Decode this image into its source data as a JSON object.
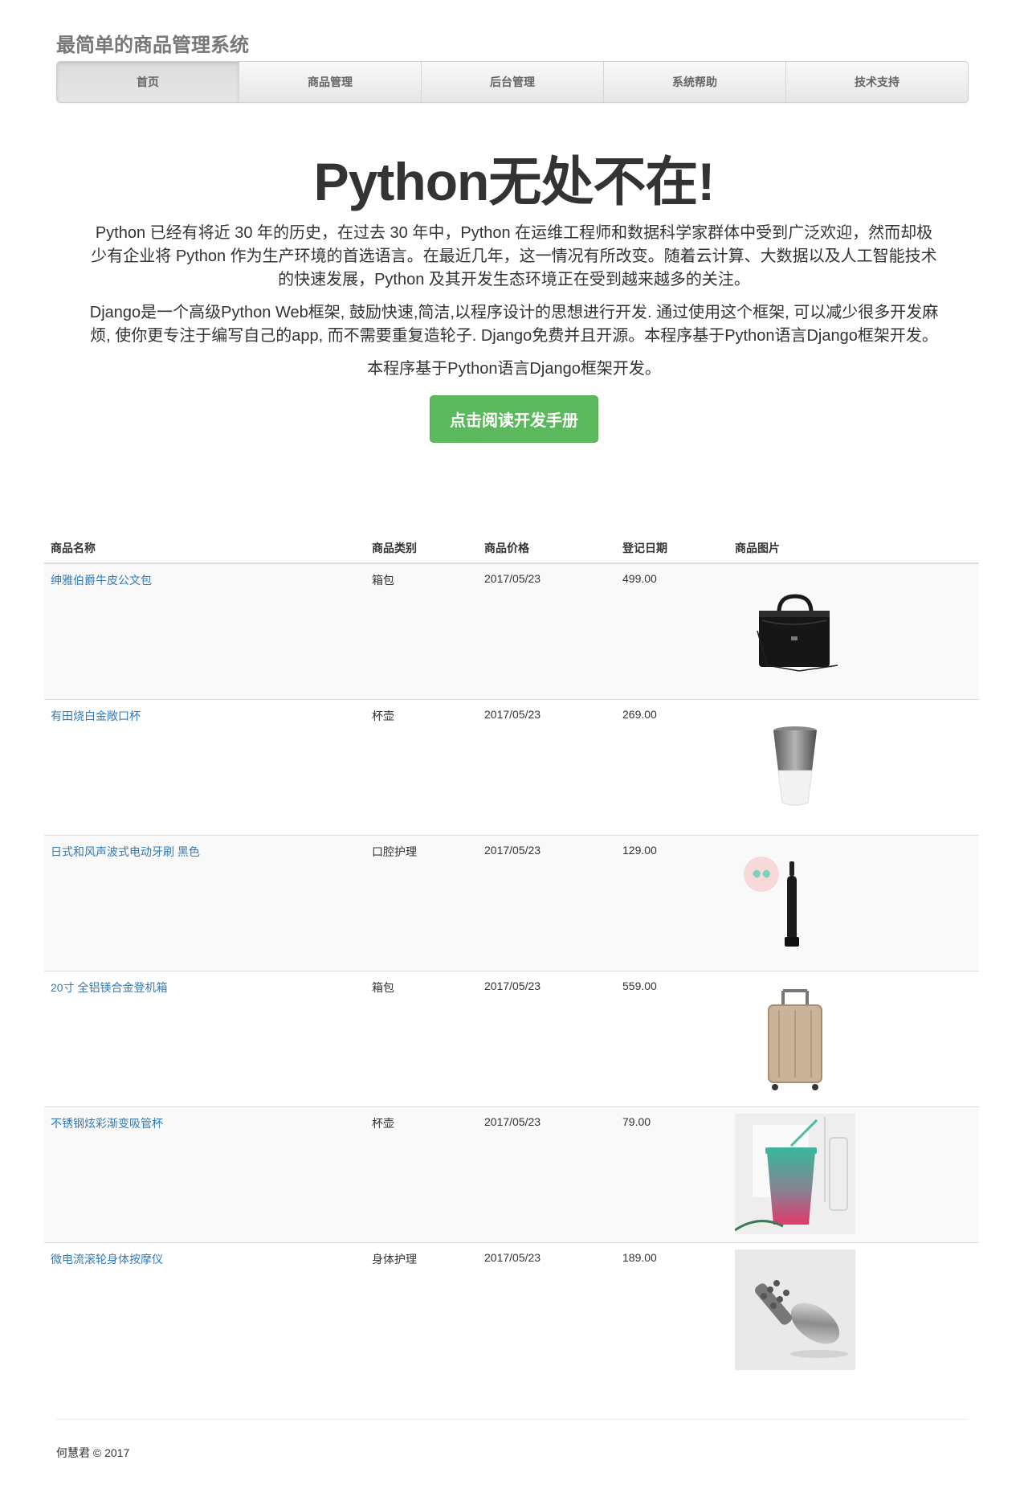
{
  "header": {
    "site_title": "最简单的商品管理系统"
  },
  "nav": {
    "items": [
      {
        "label": "首页",
        "active": true
      },
      {
        "label": "商品管理",
        "active": false
      },
      {
        "label": "后台管理",
        "active": false
      },
      {
        "label": "系统帮助",
        "active": false
      },
      {
        "label": "技术支持",
        "active": false
      }
    ]
  },
  "hero": {
    "title": "Python无处不在!",
    "paragraph1": "Python 已经有将近 30 年的历史，在过去 30 年中，Python 在运维工程师和数据科学家群体中受到广泛欢迎，然而却极少有企业将 Python 作为生产环境的首选语言。在最近几年，这一情况有所改变。随着云计算、大数据以及人工智能技术的快速发展，Python 及其开发生态环境正在受到越来越多的关注。",
    "paragraph2": "Django是一个高级Python Web框架, 鼓励快速,简洁,以程序设计的思想进行开发. 通过使用这个框架, 可以减少很多开发麻烦, 使你更专注于编写自己的app, 而不需要重复造轮子. Django免费并且开源。本程序基于Python语言Django框架开发。",
    "paragraph3": "本程序基于Python语言Django框架开发。",
    "button_label": "点击阅读开发手册"
  },
  "table": {
    "headers": {
      "name": "商品名称",
      "category": "商品类别",
      "price": "商品价格",
      "date": "登记日期",
      "image": "商品图片"
    },
    "rows": [
      {
        "name": "绅雅伯爵牛皮公文包",
        "category": "箱包",
        "col3": "2017/05/23",
        "col4": "499.00",
        "image_icon": "briefcase-image"
      },
      {
        "name": "有田烧白金敞口杯",
        "category": "杯壶",
        "col3": "2017/05/23",
        "col4": "269.00",
        "image_icon": "cup-image"
      },
      {
        "name": "日式和风声波式电动牙刷 黑色",
        "category": "口腔护理",
        "col3": "2017/05/23",
        "col4": "129.00",
        "image_icon": "toothbrush-image"
      },
      {
        "name": "20寸 全铝镁合金登机箱",
        "category": "箱包",
        "col3": "2017/05/23",
        "col4": "559.00",
        "image_icon": "suitcase-image"
      },
      {
        "name": "不锈钢炫彩渐变吸管杯",
        "category": "杯壶",
        "col3": "2017/05/23",
        "col4": "79.00",
        "image_icon": "tumbler-image"
      },
      {
        "name": "微电流滚轮身体按摩仪",
        "category": "身体护理",
        "col3": "2017/05/23",
        "col4": "189.00",
        "image_icon": "massager-image"
      }
    ]
  },
  "footer": {
    "text": "何慧君 © 2017"
  }
}
